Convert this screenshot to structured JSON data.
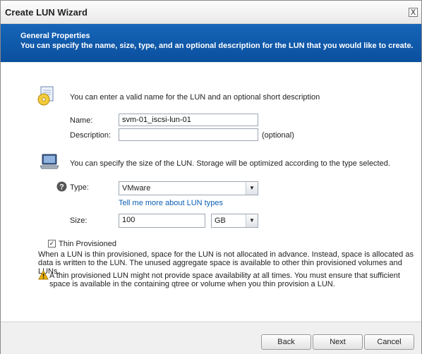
{
  "window": {
    "title": "Create LUN Wizard",
    "close_label": "X"
  },
  "banner": {
    "title": "General Properties",
    "subtitle": "You can specify the name, size, type, and an optional description for the LUN that you would like to create."
  },
  "name_section": {
    "intro": "You can enter a valid name for the LUN and an optional short description",
    "name_label": "Name:",
    "name_value": "svm-01_iscsi-lun-01",
    "description_label": "Description:",
    "description_value": "",
    "optional_note": "(optional)"
  },
  "size_section": {
    "intro": "You can specify the size of the LUN. Storage will be optimized according to the type selected.",
    "type_label": "Type:",
    "type_value": "VMware",
    "type_link": "Tell me more about LUN types",
    "size_label": "Size:",
    "size_value": "100",
    "unit_value": "GB"
  },
  "thin": {
    "label": "Thin Provisioned",
    "checked": true,
    "para1_line1": "When a LUN is thin provisioned, space for the LUN is not allocated in advance. Instead, space is allocated as",
    "para1_line2": "data is written to the LUN. The unused aggregate space is available to other thin provisioned volumes and LUNs.",
    "warning_line1": "A thin provisioned LUN might not provide space availability at all times. You must ensure that sufficient",
    "warning_line2": "space is available in the containing qtree or volume when you thin provision a LUN."
  },
  "footer": {
    "back_label": "Back",
    "next_label": "Next",
    "cancel_label": "Cancel"
  },
  "colors": {
    "banner": "#0b4f9e",
    "link": "#0b5fb3",
    "warning": "#f2b705"
  }
}
